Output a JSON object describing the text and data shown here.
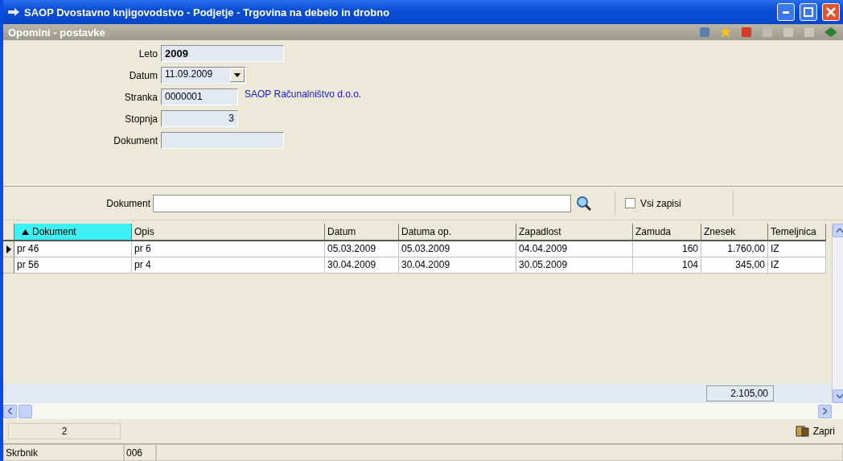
{
  "window": {
    "title": "SAOP  Dvostavno knjigovodstvo - Podjetje - Trgovina na debelo in drobno"
  },
  "panel": {
    "title": "Opomini - postavke"
  },
  "form": [
    {
      "label": "Leto",
      "value": "2009",
      "kind": "bold"
    },
    {
      "label": "Datum",
      "value": "11.09.2009",
      "kind": "date"
    },
    {
      "label": "Stranka",
      "value": "0000001",
      "kind": "text",
      "note": "SAOP Računalništvo d.o.o."
    },
    {
      "label": "Stopnja",
      "value": "3",
      "kind": "number"
    },
    {
      "label": "Dokument",
      "kind": "wide"
    }
  ],
  "search": {
    "label": "Dokument",
    "all_records": {
      "label": "Vsi zapisi",
      "checked": false
    }
  },
  "table": {
    "columns": [
      {
        "label": "Dokument",
        "sorted": true,
        "kind": "text"
      },
      {
        "label": "Opis",
        "sorted": false,
        "kind": "text"
      },
      {
        "label": "Datum",
        "sorted": false,
        "kind": "text"
      },
      {
        "label": "Datuma op.",
        "sorted": false,
        "kind": "text"
      },
      {
        "label": "Zapadlost",
        "sorted": false,
        "kind": "text"
      },
      {
        "label": "Zamuda",
        "sorted": false,
        "kind": "number"
      },
      {
        "label": "Znesek",
        "sorted": false,
        "kind": "number"
      },
      {
        "label": "Temeljnica",
        "sorted": false,
        "kind": "text"
      }
    ],
    "rows": [
      {
        "selected": true,
        "cells": [
          "pr 46",
          "pr 6",
          "05.03.2009",
          "05.03.2009",
          "04.04.2009",
          "160",
          "1.760,00",
          "IZ"
        ]
      },
      {
        "selected": false,
        "cells": [
          "pr 56",
          "pr 4",
          "30.04.2009",
          "30.04.2009",
          "30.05.2009",
          "104",
          "345,00",
          "IZ"
        ]
      }
    ],
    "total": "2.105,00"
  },
  "footer": {
    "count": "2",
    "close": "Zapri"
  },
  "status_bar": [
    "Skrbnik",
    "006"
  ]
}
